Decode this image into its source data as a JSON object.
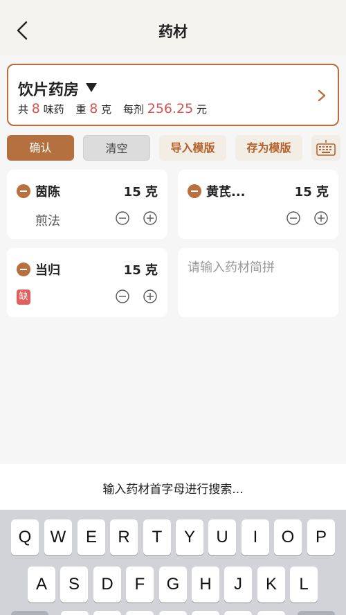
{
  "header": {
    "title": "药材"
  },
  "pharmacy": {
    "name": "饮片药房",
    "stats": {
      "total_prefix": "共",
      "total_count": "8",
      "total_unit": "味药",
      "weight_prefix": "重",
      "weight_value": "8",
      "weight_unit": "克",
      "per_dose_prefix": "每剂",
      "per_dose_value": "256.25",
      "per_dose_unit": "元"
    }
  },
  "actions": {
    "confirm": "确认",
    "clear": "清空",
    "import_template": "导入模版",
    "save_template": "存为模版"
  },
  "herbs": [
    {
      "name": "茵陈",
      "qty": "15 克",
      "method": "煎法"
    },
    {
      "name": "黄芪...",
      "qty": "15 克"
    },
    {
      "name": "当归",
      "qty": "15 克",
      "shortage": "缺"
    }
  ],
  "search": {
    "placeholder": "请输入药材简拼"
  },
  "hint": "输入药材首字母进行搜索...",
  "keyboard": {
    "row1": [
      "Q",
      "W",
      "E",
      "R",
      "T",
      "Y",
      "U",
      "I",
      "O",
      "P"
    ],
    "row2": [
      "A",
      "S",
      "D",
      "F",
      "G",
      "H",
      "J",
      "K",
      "L"
    ]
  },
  "colors": {
    "accent": "#b5703f",
    "price_red": "#d9534f",
    "shortage_red": "#e06060"
  }
}
